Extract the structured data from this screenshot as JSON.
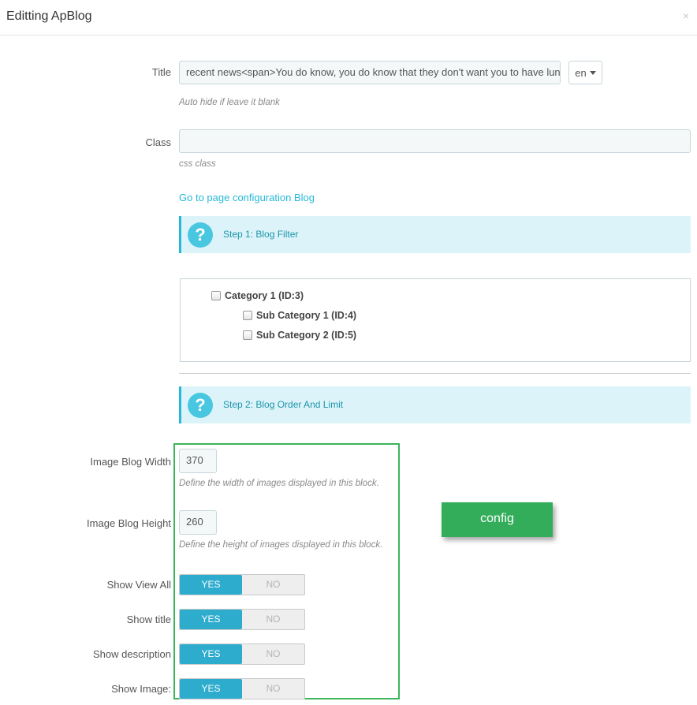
{
  "modal": {
    "title": "Editting ApBlog",
    "close": "×"
  },
  "title_field": {
    "label": "Title",
    "value": "recent news<span>You do know, you do know that they don't want you to have lunc",
    "lang": "en",
    "help": "Auto hide if leave it blank"
  },
  "class_field": {
    "label": "Class",
    "value": "",
    "help": "css class"
  },
  "config_link": "Go to page configuration Blog",
  "step1": {
    "icon": "question-icon",
    "text": "Step 1: Blog Filter"
  },
  "categories": [
    {
      "label": "Category 1 (ID:3)",
      "checked": false
    },
    {
      "label": "Sub Category 1 (ID:4)",
      "checked": false
    },
    {
      "label": "Sub Category 2 (ID:5)",
      "checked": false
    }
  ],
  "step2": {
    "icon": "question-icon",
    "text": "Step 2: Blog Order And Limit"
  },
  "image_width": {
    "label": "Image Blog Width",
    "value": "370",
    "help": "Define the width of images displayed in this block."
  },
  "image_height": {
    "label": "Image Blog Height",
    "value": "260",
    "help": "Define the height of images displayed in this block."
  },
  "switches": [
    {
      "label": "Show View All",
      "yes": "YES",
      "no": "NO",
      "value": "YES"
    },
    {
      "label": "Show title",
      "yes": "YES",
      "no": "NO",
      "value": "YES"
    },
    {
      "label": "Show description",
      "yes": "YES",
      "no": "NO",
      "value": "YES"
    },
    {
      "label": "Show Image:",
      "yes": "YES",
      "no": "NO",
      "value": "YES"
    }
  ],
  "config_button": "config",
  "colors": {
    "accent": "#25b9d7",
    "switch_on": "#2eacce",
    "highlight_border": "#3cb55a",
    "config_button": "#33ad5a"
  }
}
